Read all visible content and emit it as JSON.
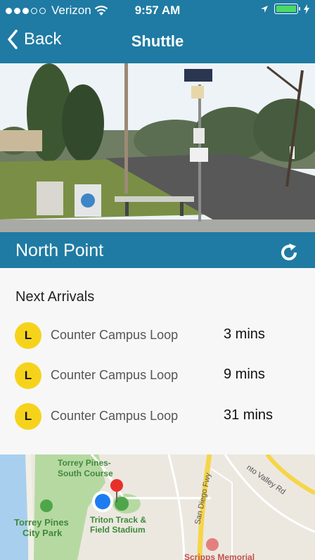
{
  "status_bar": {
    "carrier": "Verizon",
    "time": "9:57 AM"
  },
  "nav": {
    "back_label": "Back",
    "title": "Shuttle"
  },
  "stop": {
    "name": "North Point"
  },
  "arrivals": {
    "header": "Next Arrivals",
    "items": [
      {
        "badge": "L",
        "route": "Counter Campus Loop",
        "eta": "3 mins"
      },
      {
        "badge": "L",
        "route": "Counter Campus Loop",
        "eta": "9 mins"
      },
      {
        "badge": "L",
        "route": "Counter Campus Loop",
        "eta": "31 mins"
      }
    ]
  },
  "map": {
    "labels": {
      "torrey_pines_south": "Torrey Pines-",
      "torrey_pines_south_2": "South Course",
      "torrey_pines_park": "Torrey Pines",
      "torrey_pines_park_2": "City Park",
      "triton": "Triton Track &",
      "triton_2": "Field Stadium",
      "sd_fwy": "San Diego Fwy",
      "scripps": "Scripps Memorial",
      "valley": "nto Valley Rd"
    }
  }
}
